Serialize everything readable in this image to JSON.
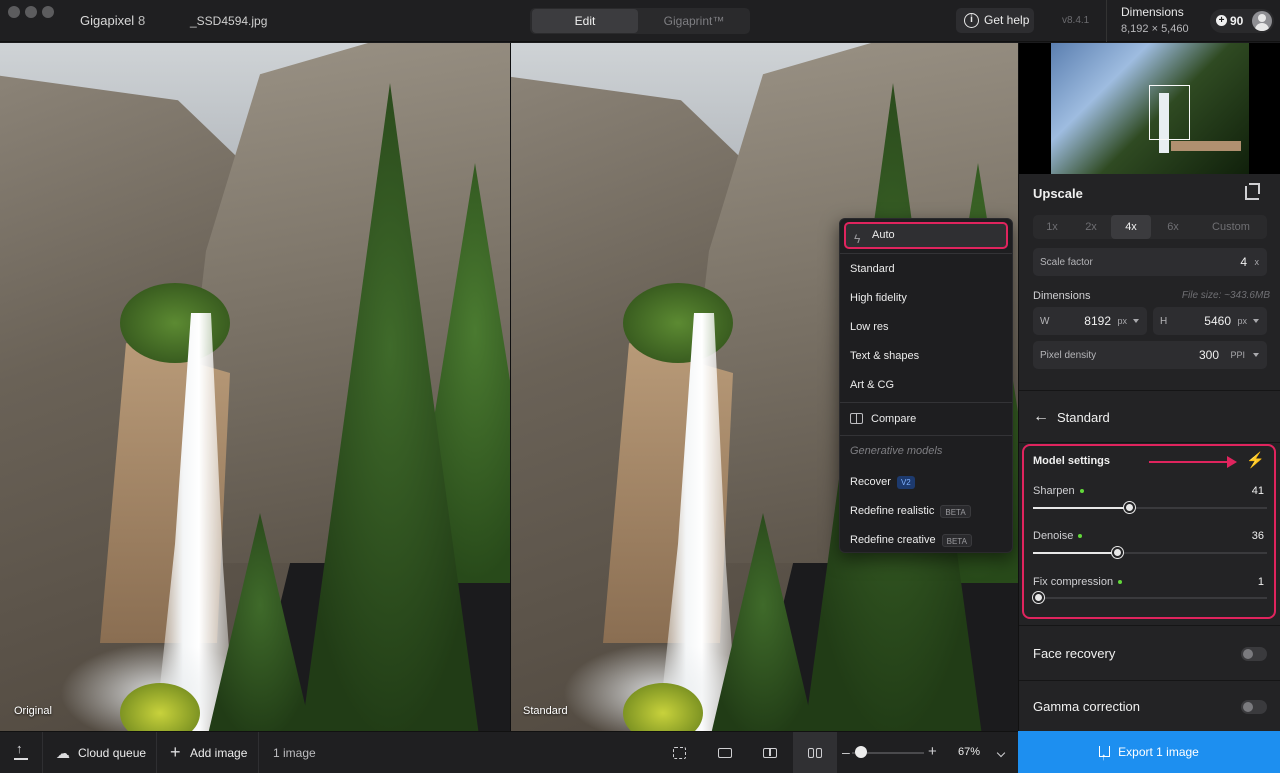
{
  "window": {
    "app_name": "Gigapixel",
    "app_version_major": "8",
    "file_name": "_SSD4594.jpg",
    "version": "v8.4.1"
  },
  "tabs": [
    {
      "label": "Edit",
      "active": true
    },
    {
      "label": "Gigaprint™",
      "active": false
    }
  ],
  "header": {
    "help_label": "Get help",
    "dimensions_label": "Dimensions",
    "dimensions_value": "8,192 × 5,460",
    "credits": "90"
  },
  "canvas": {
    "left_label": "Original",
    "right_label": "Standard"
  },
  "model_menu": {
    "auto_label": "Auto",
    "items": [
      "Standard",
      "High fidelity",
      "Low res",
      "Text & shapes",
      "Art & CG"
    ],
    "compare_label": "Compare",
    "generative_header": "Generative models",
    "generative": [
      {
        "label": "Recover",
        "badge": "V2"
      },
      {
        "label": "Redefine realistic",
        "badge": "BETA"
      },
      {
        "label": "Redefine creative",
        "badge": "BETA"
      }
    ]
  },
  "panel": {
    "upscale_title": "Upscale",
    "scale_options": [
      {
        "label": "1x",
        "active": false
      },
      {
        "label": "2x",
        "active": false
      },
      {
        "label": "4x",
        "active": true
      },
      {
        "label": "6x",
        "active": false
      },
      {
        "label": "Custom",
        "active": false
      }
    ],
    "scale_factor_label": "Scale factor",
    "scale_factor_value": "4",
    "scale_factor_unit": "x",
    "dimensions_label": "Dimensions",
    "file_size": "File size: ~343.6MB",
    "width_label": "W",
    "width_value": "8192",
    "width_unit": "px",
    "height_label": "H",
    "height_value": "5460",
    "height_unit": "px",
    "density_label": "Pixel density",
    "density_value": "300",
    "density_unit": "PPI",
    "model_name": "Standard",
    "model_settings_title": "Model settings",
    "sliders": [
      {
        "label": "Sharpen",
        "value": "41",
        "fraction": 0.41
      },
      {
        "label": "Denoise",
        "value": "36",
        "fraction": 0.36
      },
      {
        "label": "Fix compression",
        "value": "1",
        "fraction": 0.01
      }
    ],
    "face_recovery_label": "Face recovery",
    "face_recovery_on": false,
    "gamma_label": "Gamma correction",
    "gamma_on": false
  },
  "bottom": {
    "cloud_queue_label": "Cloud queue",
    "add_image_label": "Add image",
    "image_count": "1 image",
    "zoom": "67%",
    "zoom_fraction": 0.12,
    "export_label": "Export 1 image"
  },
  "colors": {
    "accent_blue": "#1d8ff0",
    "highlight_pink": "#e0245e",
    "bolt_green": "#62d83a"
  },
  "icons": [
    "help-icon",
    "credits-icon",
    "avatar",
    "crop-icon",
    "back-arrow-icon",
    "bolt-icon",
    "upload-icon",
    "cloud-icon",
    "plus-icon",
    "compare-icon",
    "export-icon"
  ]
}
